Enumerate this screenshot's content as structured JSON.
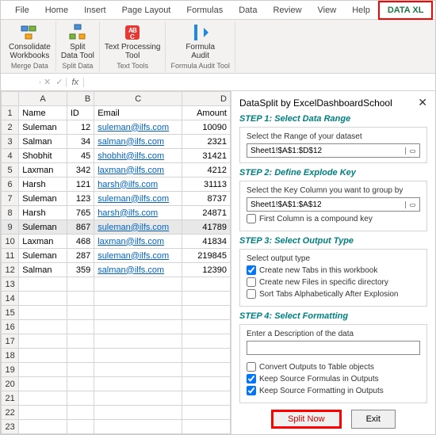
{
  "ribbon": {
    "tabs": [
      "File",
      "Home",
      "Insert",
      "Page Layout",
      "Formulas",
      "Data",
      "Review",
      "View",
      "Help",
      "DATA XL"
    ],
    "groups": [
      {
        "label": "Consolidate\nWorkbooks",
        "name": "Merge Data",
        "icon": "consolidate"
      },
      {
        "label": "Split\nData Tool",
        "name": "Split Data",
        "icon": "split"
      },
      {
        "label": "Text Processing\nTool",
        "name": "Text Tools",
        "icon": "text"
      },
      {
        "label": "Formula\nAudit",
        "name": "Formula Audit Tool",
        "icon": "audit"
      }
    ]
  },
  "formula_bar": {
    "name_box": "",
    "fx": "fx"
  },
  "headers": [
    "A",
    "B",
    "C",
    "D"
  ],
  "col_headers": {
    "a": "Name",
    "b": "ID",
    "c": "Email",
    "d": "Amount"
  },
  "rows": [
    {
      "a": "Suleman",
      "b": "12",
      "c": "suleman@ilfs.com",
      "d": "10090"
    },
    {
      "a": "Salman",
      "b": "34",
      "c": "salman@ilfs.com",
      "d": "2321"
    },
    {
      "a": "Shobhit",
      "b": "45",
      "c": "shobhit@ilfs.com",
      "d": "31421"
    },
    {
      "a": "Laxman",
      "b": "342",
      "c": "laxman@ilfs.com",
      "d": "4212"
    },
    {
      "a": "Harsh",
      "b": "121",
      "c": "harsh@ilfs.com",
      "d": "31113"
    },
    {
      "a": "Suleman",
      "b": "123",
      "c": "suleman@ilfs.com",
      "d": "8737"
    },
    {
      "a": "Harsh",
      "b": "765",
      "c": "harsh@ilfs.com",
      "d": "24871"
    },
    {
      "a": "Suleman",
      "b": "867",
      "c": "suleman@ilfs.com",
      "d": "41789"
    },
    {
      "a": "Laxman",
      "b": "468",
      "c": "laxman@ilfs.com",
      "d": "41834"
    },
    {
      "a": "Suleman",
      "b": "287",
      "c": "suleman@ilfs.com",
      "d": "219845"
    },
    {
      "a": "Salman",
      "b": "359",
      "c": "salman@ilfs.com",
      "d": "12390"
    }
  ],
  "empty_rows": [
    "13",
    "14",
    "15",
    "16",
    "17",
    "18",
    "19",
    "20",
    "21",
    "22",
    "23"
  ],
  "pane": {
    "title": "DataSplit by ExcelDashboardSchool",
    "step1": {
      "h": "STEP 1:  Select Data Range",
      "lbl": "Select the Range of your dataset",
      "val": "Sheet1!$A$1:$D$12"
    },
    "step2": {
      "h": "STEP 2:  Define Explode Key",
      "lbl": "Select the Key Column you want to group by",
      "val": "Sheet1!$A$1:$A$12",
      "chk": "First Column is a compound key"
    },
    "step3": {
      "h": "STEP 3:  Select Output Type",
      "lbl": "Select output type",
      "o1": "Create new Tabs in this workbook",
      "o2": "Create new Files in specific directory",
      "o3": "Sort Tabs Alphabetically After Explosion"
    },
    "step4": {
      "h": "STEP 4:  Select Formatting",
      "lbl": "Enter a Description of the data",
      "c1": "Convert Outputs to Table objects",
      "c2": "Keep Source Formulas in Outputs",
      "c3": "Keep Source Formatting in Outputs"
    },
    "btn_split": "Split Now",
    "btn_exit": "Exit"
  }
}
